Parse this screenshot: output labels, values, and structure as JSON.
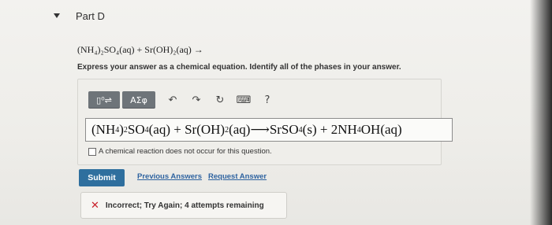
{
  "part": {
    "title": "Part D"
  },
  "question": {
    "equation": "(NH₄)₂SO₄(aq) + Sr(OH)₂(aq) →",
    "instructions": "Express your answer as a chemical equation. Identify all of the phases in your answer."
  },
  "toolbar": {
    "template_icon": "▯⁰⇌",
    "greek_label": "ΑΣφ",
    "undo_icon": "↶",
    "redo_icon": "↷",
    "reset_icon": "↻",
    "keyboard_icon": "⌨",
    "help_icon": "?"
  },
  "answer": {
    "seg1": "(NH",
    "sub1": "4",
    "seg2": ")",
    "sub2": "2",
    "seg3": " SO",
    "sub3": "4",
    "seg4": " (aq) + Sr(OH)",
    "sub4": "2",
    "seg5": " (aq)⟶SrSO",
    "sub5": "4",
    "seg6": " (s) + 2NH",
    "sub6": "4",
    "seg7": " OH(aq)"
  },
  "no_reaction_label": "A chemical reaction does not occur for this question.",
  "actions": {
    "submit": "Submit",
    "previous_answers": "Previous Answers",
    "request_answer": "Request Answer"
  },
  "feedback": {
    "icon": "✕",
    "message": "Incorrect; Try Again; 4 attempts remaining",
    "color": "#c8202a"
  }
}
